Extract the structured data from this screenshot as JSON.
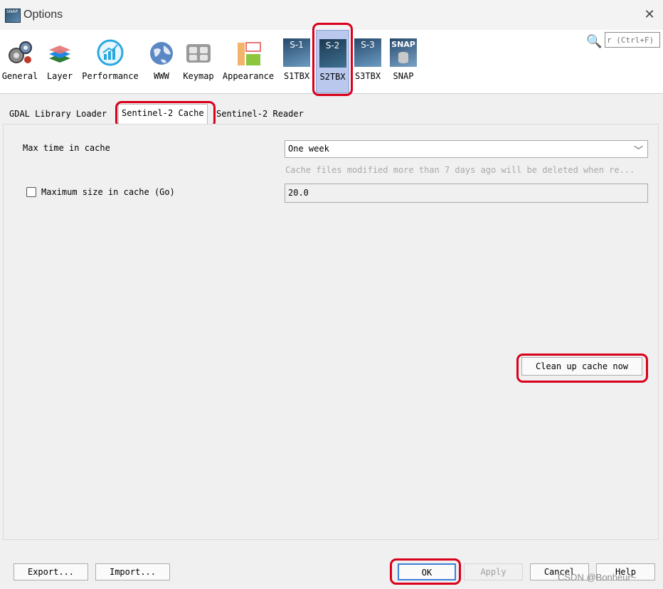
{
  "window": {
    "title": "Options",
    "close_glyph": "✕",
    "icon": "snap-app-icon",
    "icon_text": "SNAP"
  },
  "toolbar": {
    "categories": [
      {
        "label": "General",
        "icon": "gears-icon"
      },
      {
        "label": "Layer",
        "icon": "layers-icon"
      },
      {
        "label": "Performance",
        "icon": "performance-chart-icon"
      },
      {
        "label": "WWW",
        "icon": "globe-icon"
      },
      {
        "label": "Keymap",
        "icon": "keyboard-icon"
      },
      {
        "label": "Appearance",
        "icon": "appearance-icon"
      },
      {
        "label": "S1TBX",
        "icon": "s1-icon",
        "badge": "S-1"
      },
      {
        "label": "S2TBX",
        "icon": "s2-icon",
        "badge": "S-2",
        "selected": true
      },
      {
        "label": "S3TBX",
        "icon": "s3-icon",
        "badge": "S-3"
      },
      {
        "label": "SNAP",
        "icon": "snap-icon",
        "badge": "SNAP"
      }
    ],
    "search": {
      "icon": "search-icon",
      "placeholder": "r (Ctrl+F)"
    }
  },
  "tabs": [
    {
      "label": "GDAL Library Loader",
      "active": false
    },
    {
      "label": "Sentinel-2 Cache",
      "active": true
    },
    {
      "label": "Sentinel-2 Reader",
      "active": false
    }
  ],
  "cache_panel": {
    "max_time_label": "Max time in cache",
    "max_time_value": "One week",
    "hint": "Cache files modified more than 7 days ago will be deleted when re...",
    "max_size_label": "Maximum size in cache (Go)",
    "max_size_checked": false,
    "max_size_value": "20.0",
    "cleanup_button": "Clean up cache now"
  },
  "footer": {
    "export": "Export...",
    "import": "Import...",
    "ok": "OK",
    "apply": "Apply",
    "cancel": "Cancel",
    "help": "Help"
  },
  "watermark": "CSDN @Bonheur~",
  "colors": {
    "selected_bg": "#b9c8ec",
    "highlight_red": "#d9001b",
    "default_button_border": "#3c7fd9"
  }
}
